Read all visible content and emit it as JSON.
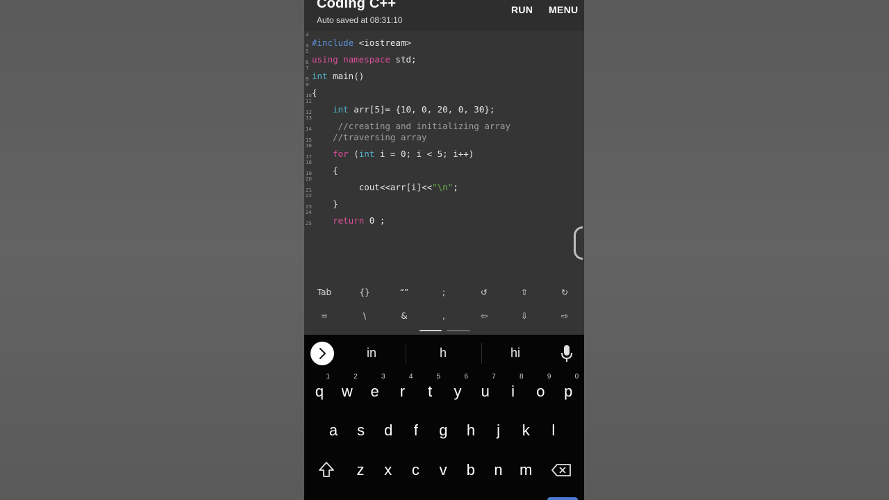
{
  "app": {
    "title": "Coding C++",
    "subtitle": "Auto saved at 08:31:10",
    "run_label": "RUN",
    "menu_label": "MENU"
  },
  "editor": {
    "lines": [
      {
        "n": "3"
      },
      {
        "n": "4",
        "text": "#include <iostream>"
      },
      {
        "n": "5"
      },
      {
        "n": "6",
        "text": "using namespace std;"
      },
      {
        "n": "7"
      },
      {
        "n": "8",
        "text": "int main()"
      },
      {
        "n": "9"
      },
      {
        "n": "10",
        "text": "{"
      },
      {
        "n": "11"
      },
      {
        "n": "12",
        "text": "    int arr[5]= {10, 0, 20, 0, 30};"
      },
      {
        "n": "13"
      },
      {
        "n": "14",
        "text": "     //creating and initializing array"
      },
      {
        "n": "15",
        "text": "    //traversing array"
      },
      {
        "n": "16"
      },
      {
        "n": "17",
        "text": "    for (int i = 0; i < 5; i++)"
      },
      {
        "n": "18"
      },
      {
        "n": "19",
        "text": "    {"
      },
      {
        "n": "20"
      },
      {
        "n": "21",
        "text": "         cout<<arr[i]<<\"\\n\";"
      },
      {
        "n": "22"
      },
      {
        "n": "23",
        "text": "    }"
      },
      {
        "n": "24"
      },
      {
        "n": "25",
        "text": "    return 0 ;"
      }
    ]
  },
  "symbols": {
    "row1": [
      "Tab",
      "{}",
      "“”",
      ";",
      "↺",
      "⇧",
      "↻"
    ],
    "row2": [
      "=",
      "\\",
      "&",
      ",",
      "⇦",
      "⇩",
      "⇨"
    ]
  },
  "keyboard": {
    "suggestions": [
      "in",
      "h",
      "hi"
    ],
    "row1": [
      {
        "k": "q",
        "h": "1"
      },
      {
        "k": "w",
        "h": "2"
      },
      {
        "k": "e",
        "h": "3"
      },
      {
        "k": "r",
        "h": "4"
      },
      {
        "k": "t",
        "h": "5"
      },
      {
        "k": "y",
        "h": "6"
      },
      {
        "k": "u",
        "h": "7"
      },
      {
        "k": "i",
        "h": "8"
      },
      {
        "k": "o",
        "h": "9"
      },
      {
        "k": "p",
        "h": "0"
      }
    ],
    "row2": [
      "a",
      "s",
      "d",
      "f",
      "g",
      "h",
      "j",
      "k",
      "l"
    ],
    "row3": [
      "z",
      "x",
      "c",
      "v",
      "b",
      "n",
      "m"
    ]
  },
  "colors": {
    "keyword_blue": "#5b8fd6",
    "keyword_pink": "#e04f9a",
    "keyword_cyan": "#4fb3c9",
    "string_green": "#6ab04c",
    "comment_gray": "#9e9e9e",
    "accent_blue": "#4a7bd0"
  }
}
